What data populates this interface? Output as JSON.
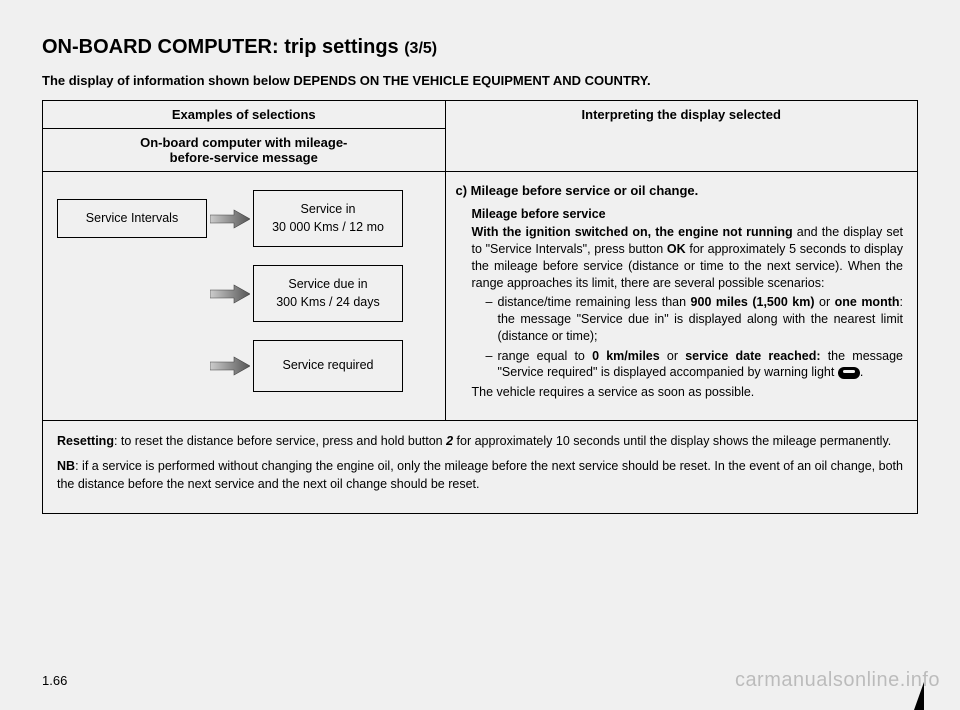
{
  "page": {
    "title_main": "ON-BOARD COMPUTER: trip settings ",
    "title_sub": "(3/5)",
    "subhead": "The display of information shown below DEPENDS ON THE VEHICLE EQUIPMENT AND COUNTRY.",
    "page_number": "1.66",
    "watermark": "carmanualsonline.info"
  },
  "table": {
    "left_head_top": "Examples of selections",
    "left_head_bottom_l1": "On-board computer with mileage-",
    "left_head_bottom_l2": "before-service message",
    "right_head": "Interpreting the display selected"
  },
  "diagram": {
    "box1": "Service Intervals",
    "box2_l1": "Service in",
    "box2_l2": "30 000 Kms / 12 mo",
    "box3_l1": "Service due in",
    "box3_l2": "300 Kms / 24 days",
    "box4": "Service required"
  },
  "interpret": {
    "section_c": "c) Mileage before service or oil change.",
    "block_title": "Mileage before service",
    "p1_a": "With the ignition switched on, the engine not running",
    "p1_b": " and the display set to \"Service Intervals\", press button ",
    "p1_ok": "OK",
    "p1_c": " for approximately 5 seconds to display the mileage before service (distance or time to the next service). When the range approaches its limit, there are several possible scenarios:",
    "li1_a": "distance/time remaining less than ",
    "li1_b": "900 miles (1,500 km)",
    "li1_c": " or ",
    "li1_d": "one month",
    "li1_e": ": the message \"Service due in\" is displayed along with the nearest limit (distance or time);",
    "li2_a": "range equal to ",
    "li2_b": "0 km/miles",
    "li2_c": " or ",
    "li2_d": "service date reached:",
    "li2_e": " the message \"Service required\" is displayed accompanied by warning light ",
    "li2_f": ".",
    "last": "The vehicle requires a service as soon as possible."
  },
  "footer": {
    "reset_b": "Resetting",
    "reset_a": ": to reset the distance before service, press and hold button ",
    "reset_num": "2",
    "reset_c": " for approximately 10 seconds until the display shows the mileage permanently.",
    "nb_b": "NB",
    "nb_a": ": if a service is performed without changing the engine oil, only the mileage before the next service should be reset. In the event of an oil change, both the distance before the next service and the next oil change should be reset."
  }
}
